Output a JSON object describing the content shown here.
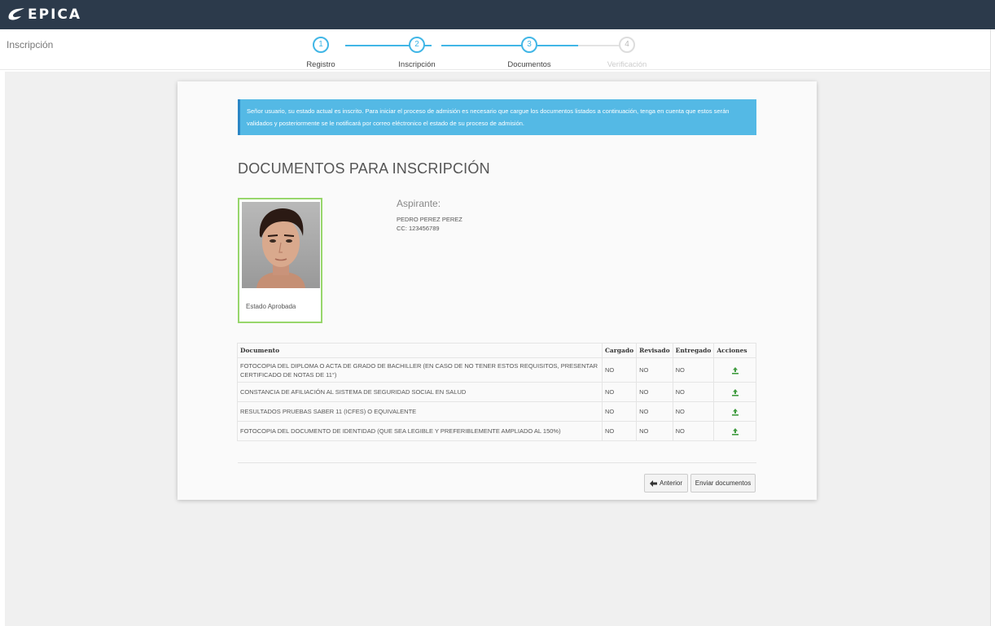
{
  "app": {
    "logo_text": "EPICA",
    "page_label": "Inscripción"
  },
  "steps": [
    {
      "number": "1",
      "label": "Registro",
      "active": true
    },
    {
      "number": "2",
      "label": "Inscripción",
      "active": true
    },
    {
      "number": "3",
      "label": "Documentos",
      "active": true
    },
    {
      "number": "4",
      "label": "Verificación",
      "active": false
    }
  ],
  "alert": {
    "text": "Señor usuario, su estado actual es inscrito. Para iniciar el proceso de admisión es necesario que cargue los documentos listados a continuación, tenga en cuenta que estos serán validados y posteriormente se le notificará por correo eléctronico el estado de su proceso de admisión."
  },
  "heading": "DOCUMENTOS PARA INSCRIPCIÓN",
  "applicant": {
    "title": "Aspirante:",
    "name": "PEDRO PEREZ PEREZ",
    "id": "CC: 123456789",
    "status": "Estado Aprobada"
  },
  "table": {
    "headers": {
      "document": "Documento",
      "loaded": "Cargado",
      "reviewed": "Revisado",
      "delivered": "Entregado",
      "actions": "Acciones"
    },
    "rows": [
      {
        "document": "FOTOCOPIA DEL DIPLOMA O ACTA DE GRADO DE BACHILLER (EN CASO DE NO TENER ESTOS REQUISITOS, PRESENTAR CERTIFICADO DE NOTAS DE 11°)",
        "loaded": "NO",
        "reviewed": "NO",
        "delivered": "NO"
      },
      {
        "document": "CONSTANCIA DE AFILIACIÓN AL SISTEMA DE SEGURIDAD SOCIAL EN SALUD",
        "loaded": "NO",
        "reviewed": "NO",
        "delivered": "NO"
      },
      {
        "document": "RESULTADOS PRUEBAS SABER 11 (ICFES) O EQUIVALENTE",
        "loaded": "NO",
        "reviewed": "NO",
        "delivered": "NO"
      },
      {
        "document": "FOTOCOPIA DEL DOCUMENTO DE IDENTIDAD (QUE SEA LEGIBLE Y PREFERIBLEMENTE AMPLIADO AL 150%)",
        "loaded": "NO",
        "reviewed": "NO",
        "delivered": "NO"
      }
    ]
  },
  "buttons": {
    "previous": "Anterior",
    "send": "Enviar documentos"
  },
  "colors": {
    "topbar": "#2c3a4b",
    "accent": "#41b6e6",
    "alert": "#54b9e5",
    "photo_border": "#97d66b",
    "upload_icon": "#3f9b3f"
  },
  "icons": {
    "logo": "epica-logo-icon",
    "upload": "upload-icon",
    "previous": "arrow-left-icon"
  }
}
